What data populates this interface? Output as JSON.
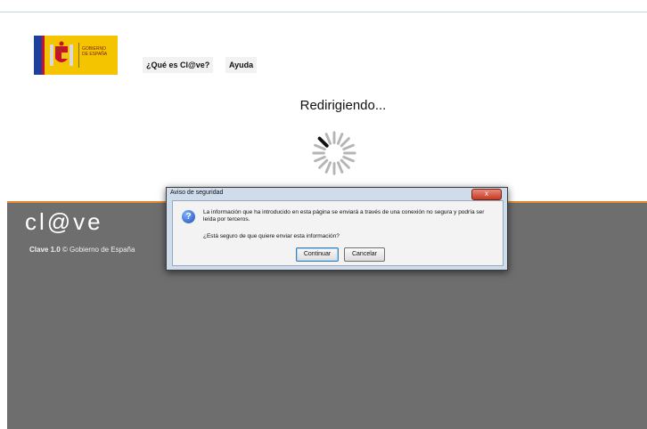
{
  "logo": {
    "text_line1": "GOBIERNO",
    "text_line2": "DE ESPAÑA"
  },
  "nav": {
    "what_is": "¿Qué es Cl@ve?",
    "help": "Ayuda"
  },
  "status": {
    "redirect_text": "Redirigiendo..."
  },
  "footer": {
    "brand": "cl@ve",
    "version": "Clave 1.0",
    "copyright": "© Gobierno de España"
  },
  "dialog": {
    "title": "Aviso de seguridad",
    "close_label": "x",
    "message": "La información que ha introducido en esta página se enviará a través de una conexión no segura y podría ser leída por terceros.",
    "question": "¿Está seguro de que quiere enviar esta información?",
    "continue_label": "Continuar",
    "cancel_label": "Cancelar"
  },
  "colors": {
    "footer_bg": "#6e6e6e",
    "accent_orange": "#e08a2d",
    "dialog_frame": "#cfdcec"
  },
  "icons": {
    "question": "question-icon",
    "close": "close-icon",
    "spinner": "loading-spinner-icon"
  }
}
